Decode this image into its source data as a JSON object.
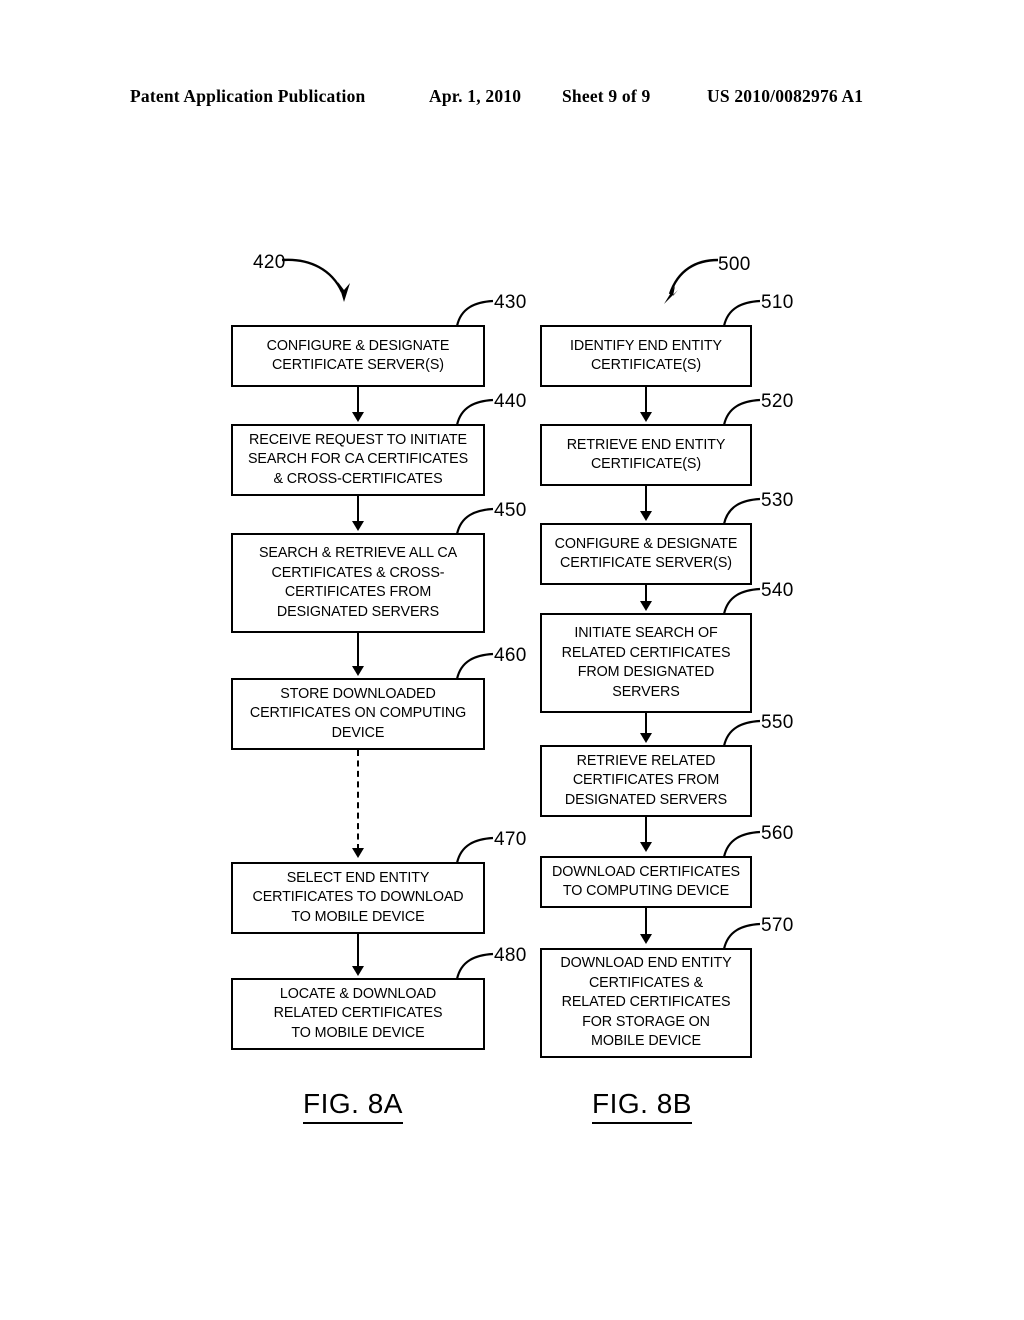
{
  "header": {
    "publication": "Patent Application Publication",
    "date": "Apr. 1, 2010",
    "sheet": "Sheet 9 of 9",
    "patent_number": "US 2010/0082976 A1"
  },
  "figures": [
    {
      "caption": "FIG. 8A",
      "diagram_ref": "420",
      "steps": [
        {
          "ref": "430",
          "text": "CONFIGURE & DESIGNATE\nCERTIFICATE SERVER(S)"
        },
        {
          "ref": "440",
          "text": "RECEIVE REQUEST TO INITIATE\nSEARCH FOR CA CERTIFICATES\n& CROSS-CERTIFICATES"
        },
        {
          "ref": "450",
          "text": "SEARCH & RETRIEVE ALL CA\nCERTIFICATES & CROSS-\nCERTIFICATES FROM\nDESIGNATED SERVERS"
        },
        {
          "ref": "460",
          "text": "STORE DOWNLOADED\nCERTIFICATES ON COMPUTING\nDEVICE"
        },
        {
          "ref": "470",
          "text": "SELECT END ENTITY\nCERTIFICATES TO DOWNLOAD\nTO MOBILE DEVICE"
        },
        {
          "ref": "480",
          "text": "LOCATE & DOWNLOAD\nRELATED CERTIFICATES\nTO MOBILE DEVICE"
        }
      ]
    },
    {
      "caption": "FIG. 8B",
      "diagram_ref": "500",
      "steps": [
        {
          "ref": "510",
          "text": "IDENTIFY END ENTITY\nCERTIFICATE(S)"
        },
        {
          "ref": "520",
          "text": "RETRIEVE END ENTITY\nCERTIFICATE(S)"
        },
        {
          "ref": "530",
          "text": "CONFIGURE & DESIGNATE\nCERTIFICATE SERVER(S)"
        },
        {
          "ref": "540",
          "text": "INITIATE SEARCH OF\nRELATED CERTIFICATES\nFROM DESIGNATED\nSERVERS"
        },
        {
          "ref": "550",
          "text": "RETRIEVE RELATED\nCERTIFICATES FROM\nDESIGNATED SERVERS"
        },
        {
          "ref": "560",
          "text": "DOWNLOAD CERTIFICATES\nTO COMPUTING DEVICE"
        },
        {
          "ref": "570",
          "text": "DOWNLOAD END ENTITY\nCERTIFICATES &\nRELATED CERTIFICATES\nFOR STORAGE ON\nMOBILE DEVICE"
        }
      ]
    }
  ]
}
